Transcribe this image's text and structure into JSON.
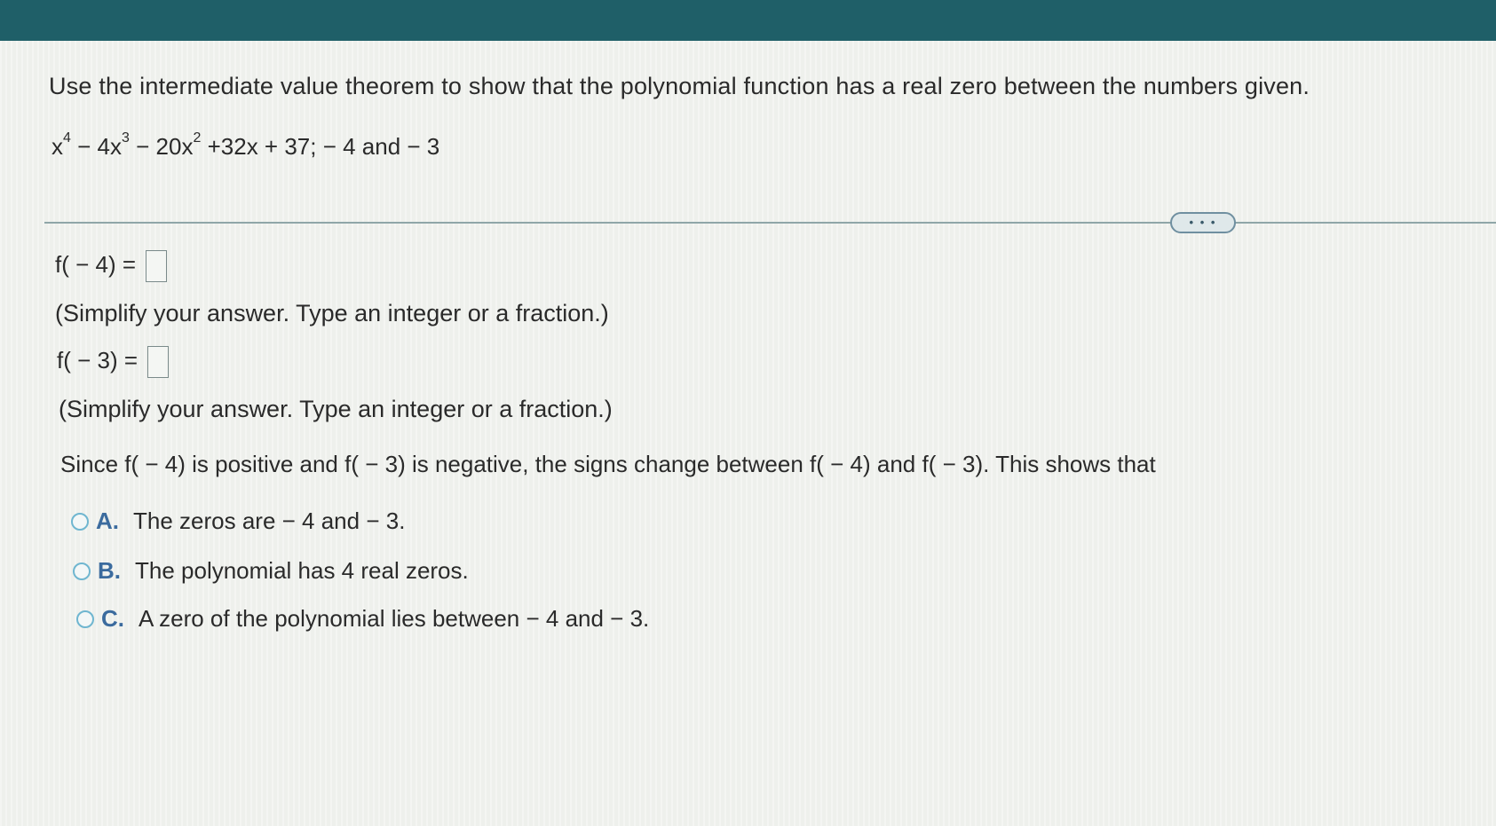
{
  "question": {
    "prompt": "Use the intermediate value theorem to show that the polynomial function has a real zero between the numbers given.",
    "poly": {
      "t1": "x",
      "e1": "4",
      "t2": " − 4x",
      "e2": "3",
      "t3": " − 20x",
      "e3": "2",
      "t4": " +32x  +  37;  − 4 and  − 3"
    }
  },
  "more_button": {
    "label": "• • •"
  },
  "part1": {
    "label": "f( − 4) =",
    "hint": "(Simplify your answer. Type an integer or a fraction.)"
  },
  "part2": {
    "label": "f( − 3) =",
    "hint": "(Simplify your answer. Type an integer or a fraction.)"
  },
  "conclusion": "Since f( − 4) is positive and f( − 3) is negative, the signs change between f( − 4) and f( − 3). This shows that",
  "choices": [
    {
      "letter": "A.",
      "text": "The zeros are  − 4  and  − 3."
    },
    {
      "letter": "B.",
      "text": "The polynomial has 4 real zeros."
    },
    {
      "letter": "C.",
      "text": "A zero of the polynomial lies between  − 4  and  − 3."
    }
  ],
  "colors": {
    "topbar": "#1f5f68",
    "radio_border": "#6fb6d0",
    "choice_letter": "#3b6b9e"
  }
}
